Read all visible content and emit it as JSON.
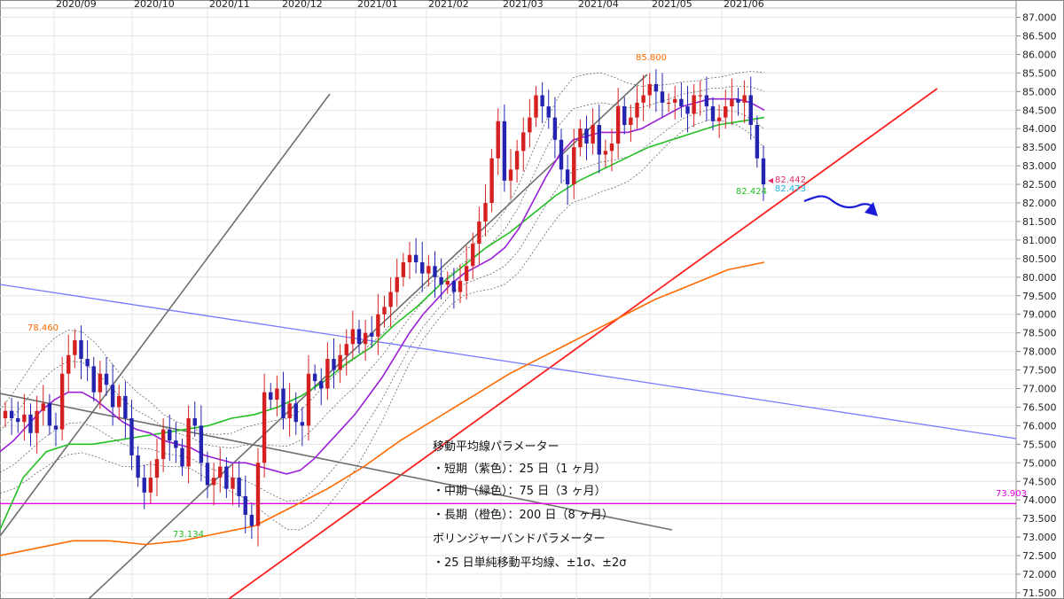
{
  "chart_data": {
    "type": "candlestick",
    "title": "",
    "y_axis": {
      "position": "right",
      "ylim": [
        71.5,
        87.0
      ],
      "ticks": [
        "87.000",
        "86.500",
        "86.000",
        "85.500",
        "85.000",
        "84.500",
        "84.000",
        "83.500",
        "83.000",
        "82.500",
        "82.000",
        "81.500",
        "81.000",
        "80.500",
        "80.000",
        "79.500",
        "79.000",
        "78.500",
        "78.000",
        "77.500",
        "77.000",
        "76.500",
        "76.000",
        "75.500",
        "75.000",
        "74.500",
        "74.000",
        "73.500",
        "73.000",
        "72.500",
        "72.000",
        "71.500"
      ]
    },
    "x_axis": {
      "position": "top",
      "month_labels": [
        "2020/09",
        "2020/10",
        "2020/11",
        "2020/12",
        "2021/01",
        "2021/02",
        "2021/03",
        "2021/04",
        "2021/05",
        "2021/06"
      ]
    },
    "grid": true,
    "legend": "none",
    "colors": {
      "up": "#d42020",
      "down": "#2424b0",
      "ma_short": "#9a1fd6",
      "ma_mid": "#22c022",
      "ma_long": "#ff6a00",
      "bollinger": "#555555",
      "trend_red": "#ff2020",
      "trend_blue": "#7878ff",
      "trend_gray": "#6e6e6e",
      "support_line": "#e600e6",
      "label_last_price": "#e0306a",
      "label_bb": "#20b0e0"
    },
    "series": {
      "price_close": [
        76.4,
        76.2,
        76.1,
        76.3,
        75.8,
        76.4,
        76.6,
        76.0,
        75.9,
        77.4,
        77.9,
        78.3,
        77.8,
        77.6,
        76.9,
        77.4,
        77.1,
        76.5,
        76.8,
        76.2,
        75.2,
        74.6,
        74.2,
        74.6,
        75.1,
        75.9,
        75.6,
        75.4,
        74.9,
        76.2,
        76.0,
        75.0,
        74.4,
        74.6,
        74.9,
        74.3,
        74.6,
        74.1,
        73.6,
        73.3,
        75.0,
        76.9,
        76.7,
        77.0,
        76.2,
        76.6,
        76.1,
        76.0,
        77.4,
        77.2,
        77.0,
        77.8,
        77.5,
        77.9,
        78.2,
        78.6,
        78.2,
        78.5,
        78.4,
        79.0,
        79.2,
        79.6,
        80.0,
        80.4,
        80.6,
        80.4,
        80.1,
        80.3,
        80.0,
        79.8,
        79.9,
        79.6,
        79.9,
        80.3,
        80.9,
        81.5,
        82.0,
        83.2,
        84.2,
        82.6,
        82.9,
        83.4,
        83.9,
        84.3,
        84.9,
        84.6,
        84.3,
        83.7,
        82.9,
        82.5,
        83.5,
        84.0,
        83.6,
        84.1,
        83.3,
        83.4,
        83.6,
        84.6,
        84.1,
        84.3,
        84.7,
        84.9,
        85.2,
        85.0,
        84.7,
        84.7,
        84.8,
        84.6,
        84.4,
        84.9,
        84.9,
        84.6,
        84.2,
        84.3,
        84.6,
        84.8,
        84.7,
        84.9,
        84.1,
        83.2,
        82.5
      ],
      "ma_short_25d": [
        75.3,
        75.6,
        76.0,
        76.4,
        76.7,
        76.9,
        76.9,
        76.7,
        76.4,
        76.1,
        75.9,
        75.8,
        75.6,
        75.5,
        75.4,
        75.2,
        75.1,
        75.0,
        75.0,
        74.9,
        74.8,
        74.7,
        74.8,
        75.1,
        75.5,
        75.9,
        76.3,
        76.8,
        77.3,
        77.9,
        78.5,
        79.0,
        79.4,
        79.8,
        80.1,
        80.3,
        80.5,
        80.8,
        81.3,
        82.0,
        82.7,
        83.3,
        83.7,
        83.8,
        83.9,
        83.9,
        83.9,
        84.0,
        84.2,
        84.4,
        84.6,
        84.7,
        84.8,
        84.8,
        84.8,
        84.7,
        84.5
      ],
      "ma_mid_75d": [
        73.2,
        74.6,
        75.3,
        75.5,
        75.5,
        75.6,
        75.7,
        75.8,
        75.9,
        76.0,
        76.2,
        76.3,
        76.5,
        76.8,
        77.2,
        77.7,
        78.1,
        78.7,
        79.2,
        79.8,
        80.3,
        80.8,
        81.2,
        81.7,
        82.2,
        82.6,
        82.9,
        83.2,
        83.5,
        83.7,
        83.9,
        84.1,
        84.2,
        84.3
      ],
      "ma_long_200d": [
        72.5,
        72.7,
        72.9,
        72.9,
        72.8,
        72.9,
        73.1,
        73.3,
        73.8,
        74.3,
        74.9,
        75.6,
        76.2,
        76.8,
        77.4,
        77.9,
        78.4,
        78.9,
        79.4,
        79.8,
        80.2,
        80.4
      ]
    },
    "annotations": [
      {
        "text": "85.800",
        "kind": "high",
        "color": "#ff6a00"
      },
      {
        "text": "78.460",
        "kind": "high",
        "color": "#ff6a00"
      },
      {
        "text": "73.134",
        "kind": "low",
        "color": "#22c022"
      },
      {
        "text": "82.424",
        "kind": "low",
        "color": "#22c022"
      },
      {
        "text": "82.442",
        "kind": "last-price",
        "color": "#e0306a"
      },
      {
        "text": "82.473",
        "kind": "bollinger",
        "color": "#20b0e0"
      },
      {
        "text": "73.903",
        "kind": "horizontal-line",
        "color": "#e600e6"
      }
    ],
    "notes": [
      "移動平均線パラメーター",
      "・短期（紫色）：25 日（1 ヶ月）",
      "・中期（緑色）：75 日（3 ヶ月）",
      "・長期（橙色）：200 日（8 ヶ月）",
      "ボリンジャーバンドパラメーター",
      "・25 日単純移動平均線、±1σ、±2σ"
    ]
  }
}
